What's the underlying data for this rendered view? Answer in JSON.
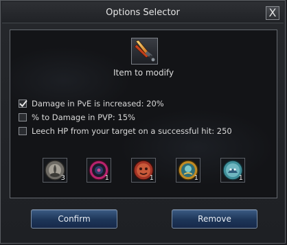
{
  "window": {
    "title": "Options Selector",
    "close_label": "X"
  },
  "item": {
    "label": "Item to modify",
    "icon": "crossed-daggers-icon"
  },
  "options": [
    {
      "label": "Damage in PvE is increased: 20%",
      "checked": true
    },
    {
      "label": "% to Damage in PVP: 15%",
      "checked": false
    },
    {
      "label": "Leech HP from your target on a successful hit: 250",
      "checked": false
    }
  ],
  "gems": [
    {
      "icon": "gray-orb-icon",
      "count": "3"
    },
    {
      "icon": "magenta-orb-icon",
      "count": "1"
    },
    {
      "icon": "red-orb-icon",
      "count": "1"
    },
    {
      "icon": "gold-orb-icon",
      "count": "1"
    },
    {
      "icon": "teal-orb-icon",
      "count": "1"
    }
  ],
  "buttons": {
    "confirm": "Confirm",
    "remove": "Remove"
  }
}
